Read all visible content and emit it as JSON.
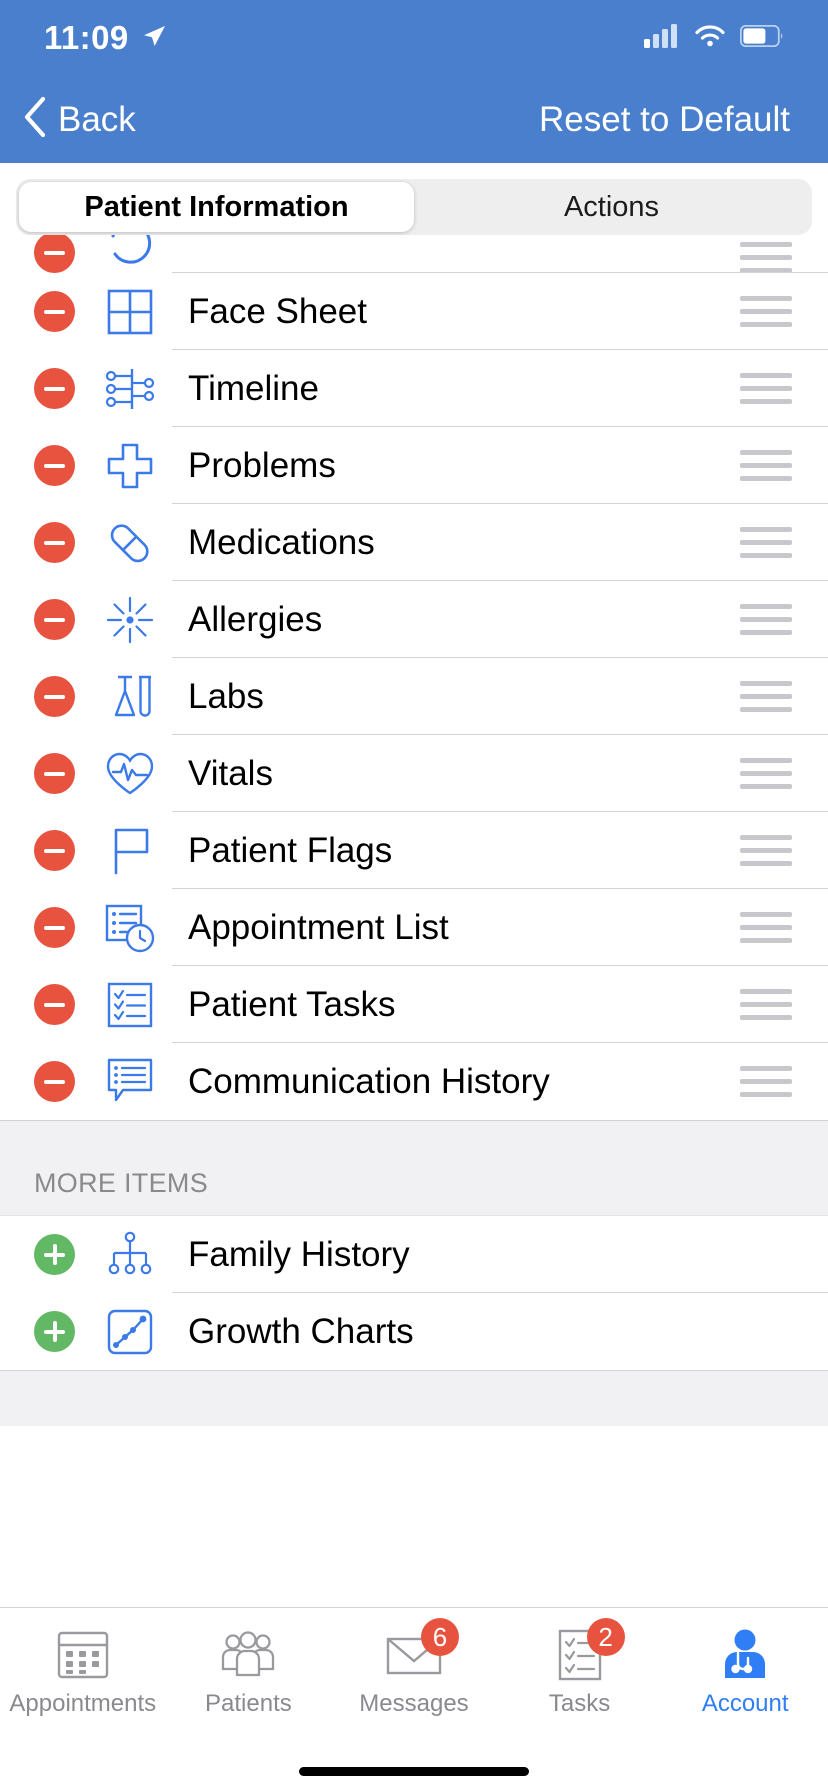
{
  "theme": {
    "header_blue": "#4a7fcd",
    "icon_blue": "#3b7ae8",
    "remove_red": "#e8533f",
    "add_green": "#62b865",
    "active_tab_blue": "#2f7ef5",
    "section_bg": "#f1f1f4"
  },
  "status_bar": {
    "time": "11:09",
    "location_icon": "location-arrow-icon",
    "cellular_icon": "cellular-bars-icon",
    "wifi_icon": "wifi-icon",
    "battery_icon": "battery-icon"
  },
  "nav": {
    "back_label": "Back",
    "back_icon": "chevron-left-icon",
    "reset_label": "Reset to Default"
  },
  "segmented_control": {
    "selected": "Patient Information",
    "options": [
      {
        "label": "Patient Information",
        "active": true
      },
      {
        "label": "Actions",
        "active": false
      }
    ]
  },
  "visible_items": {
    "partial_top_row": {
      "label": "",
      "action": "remove",
      "icon": "history-icon",
      "partial": true
    },
    "rows": [
      {
        "label": "Face Sheet",
        "action": "remove",
        "icon": "grid-2x2-icon",
        "reorderable": true
      },
      {
        "label": "Timeline",
        "action": "remove",
        "icon": "timeline-nodes-icon",
        "reorderable": true
      },
      {
        "label": "Problems",
        "action": "remove",
        "icon": "medical-cross-icon",
        "reorderable": true
      },
      {
        "label": "Medications",
        "action": "remove",
        "icon": "pill-capsule-icon",
        "reorderable": true
      },
      {
        "label": "Allergies",
        "action": "remove",
        "icon": "allergy-starburst-icon",
        "reorderable": true
      },
      {
        "label": "Labs",
        "action": "remove",
        "icon": "lab-flask-tube-icon",
        "reorderable": true
      },
      {
        "label": "Vitals",
        "action": "remove",
        "icon": "heart-pulse-icon",
        "reorderable": true
      },
      {
        "label": "Patient Flags",
        "action": "remove",
        "icon": "flag-icon",
        "reorderable": true
      },
      {
        "label": "Appointment List",
        "action": "remove",
        "icon": "list-clock-icon",
        "reorderable": true
      },
      {
        "label": "Patient Tasks",
        "action": "remove",
        "icon": "checklist-box-icon",
        "reorderable": true
      },
      {
        "label": "Communication History",
        "action": "remove",
        "icon": "chat-list-bubble-icon",
        "reorderable": true
      }
    ]
  },
  "more_items": {
    "header": "MORE ITEMS",
    "rows": [
      {
        "label": "Family History",
        "action": "add",
        "icon": "family-tree-icon",
        "reorderable": false
      },
      {
        "label": "Growth Charts",
        "action": "add",
        "icon": "growth-chart-icon",
        "reorderable": false
      }
    ]
  },
  "tab_bar": {
    "tabs": [
      {
        "label": "Appointments",
        "icon": "calendar-icon",
        "badge": null,
        "active": false
      },
      {
        "label": "Patients",
        "icon": "people-group-icon",
        "badge": null,
        "active": false
      },
      {
        "label": "Messages",
        "icon": "envelope-icon",
        "badge": "6",
        "active": false
      },
      {
        "label": "Tasks",
        "icon": "task-checklist-icon",
        "badge": "2",
        "active": false
      },
      {
        "label": "Account",
        "icon": "doctor-stethoscope-icon",
        "badge": null,
        "active": true
      }
    ]
  }
}
